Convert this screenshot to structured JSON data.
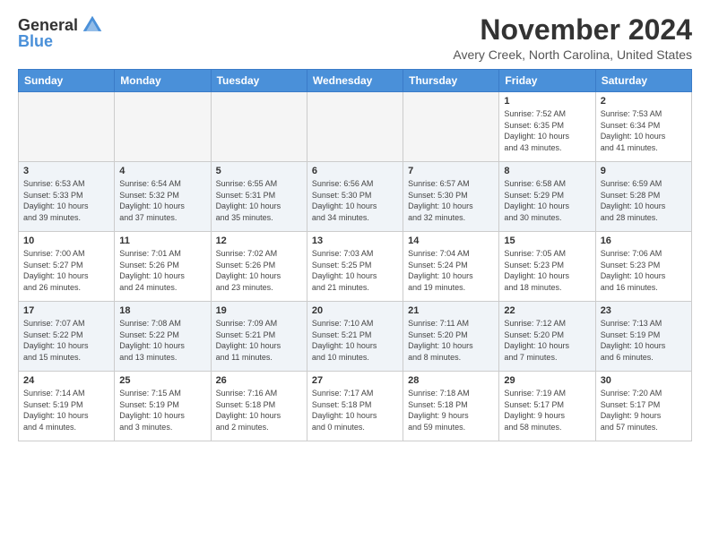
{
  "logo": {
    "general": "General",
    "blue": "Blue"
  },
  "header": {
    "month": "November 2024",
    "location": "Avery Creek, North Carolina, United States"
  },
  "weekdays": [
    "Sunday",
    "Monday",
    "Tuesday",
    "Wednesday",
    "Thursday",
    "Friday",
    "Saturday"
  ],
  "weeks": [
    [
      {
        "day": "",
        "info": ""
      },
      {
        "day": "",
        "info": ""
      },
      {
        "day": "",
        "info": ""
      },
      {
        "day": "",
        "info": ""
      },
      {
        "day": "",
        "info": ""
      },
      {
        "day": "1",
        "info": "Sunrise: 7:52 AM\nSunset: 6:35 PM\nDaylight: 10 hours\nand 43 minutes."
      },
      {
        "day": "2",
        "info": "Sunrise: 7:53 AM\nSunset: 6:34 PM\nDaylight: 10 hours\nand 41 minutes."
      }
    ],
    [
      {
        "day": "3",
        "info": "Sunrise: 6:53 AM\nSunset: 5:33 PM\nDaylight: 10 hours\nand 39 minutes."
      },
      {
        "day": "4",
        "info": "Sunrise: 6:54 AM\nSunset: 5:32 PM\nDaylight: 10 hours\nand 37 minutes."
      },
      {
        "day": "5",
        "info": "Sunrise: 6:55 AM\nSunset: 5:31 PM\nDaylight: 10 hours\nand 35 minutes."
      },
      {
        "day": "6",
        "info": "Sunrise: 6:56 AM\nSunset: 5:30 PM\nDaylight: 10 hours\nand 34 minutes."
      },
      {
        "day": "7",
        "info": "Sunrise: 6:57 AM\nSunset: 5:30 PM\nDaylight: 10 hours\nand 32 minutes."
      },
      {
        "day": "8",
        "info": "Sunrise: 6:58 AM\nSunset: 5:29 PM\nDaylight: 10 hours\nand 30 minutes."
      },
      {
        "day": "9",
        "info": "Sunrise: 6:59 AM\nSunset: 5:28 PM\nDaylight: 10 hours\nand 28 minutes."
      }
    ],
    [
      {
        "day": "10",
        "info": "Sunrise: 7:00 AM\nSunset: 5:27 PM\nDaylight: 10 hours\nand 26 minutes."
      },
      {
        "day": "11",
        "info": "Sunrise: 7:01 AM\nSunset: 5:26 PM\nDaylight: 10 hours\nand 24 minutes."
      },
      {
        "day": "12",
        "info": "Sunrise: 7:02 AM\nSunset: 5:26 PM\nDaylight: 10 hours\nand 23 minutes."
      },
      {
        "day": "13",
        "info": "Sunrise: 7:03 AM\nSunset: 5:25 PM\nDaylight: 10 hours\nand 21 minutes."
      },
      {
        "day": "14",
        "info": "Sunrise: 7:04 AM\nSunset: 5:24 PM\nDaylight: 10 hours\nand 19 minutes."
      },
      {
        "day": "15",
        "info": "Sunrise: 7:05 AM\nSunset: 5:23 PM\nDaylight: 10 hours\nand 18 minutes."
      },
      {
        "day": "16",
        "info": "Sunrise: 7:06 AM\nSunset: 5:23 PM\nDaylight: 10 hours\nand 16 minutes."
      }
    ],
    [
      {
        "day": "17",
        "info": "Sunrise: 7:07 AM\nSunset: 5:22 PM\nDaylight: 10 hours\nand 15 minutes."
      },
      {
        "day": "18",
        "info": "Sunrise: 7:08 AM\nSunset: 5:22 PM\nDaylight: 10 hours\nand 13 minutes."
      },
      {
        "day": "19",
        "info": "Sunrise: 7:09 AM\nSunset: 5:21 PM\nDaylight: 10 hours\nand 11 minutes."
      },
      {
        "day": "20",
        "info": "Sunrise: 7:10 AM\nSunset: 5:21 PM\nDaylight: 10 hours\nand 10 minutes."
      },
      {
        "day": "21",
        "info": "Sunrise: 7:11 AM\nSunset: 5:20 PM\nDaylight: 10 hours\nand 8 minutes."
      },
      {
        "day": "22",
        "info": "Sunrise: 7:12 AM\nSunset: 5:20 PM\nDaylight: 10 hours\nand 7 minutes."
      },
      {
        "day": "23",
        "info": "Sunrise: 7:13 AM\nSunset: 5:19 PM\nDaylight: 10 hours\nand 6 minutes."
      }
    ],
    [
      {
        "day": "24",
        "info": "Sunrise: 7:14 AM\nSunset: 5:19 PM\nDaylight: 10 hours\nand 4 minutes."
      },
      {
        "day": "25",
        "info": "Sunrise: 7:15 AM\nSunset: 5:19 PM\nDaylight: 10 hours\nand 3 minutes."
      },
      {
        "day": "26",
        "info": "Sunrise: 7:16 AM\nSunset: 5:18 PM\nDaylight: 10 hours\nand 2 minutes."
      },
      {
        "day": "27",
        "info": "Sunrise: 7:17 AM\nSunset: 5:18 PM\nDaylight: 10 hours\nand 0 minutes."
      },
      {
        "day": "28",
        "info": "Sunrise: 7:18 AM\nSunset: 5:18 PM\nDaylight: 9 hours\nand 59 minutes."
      },
      {
        "day": "29",
        "info": "Sunrise: 7:19 AM\nSunset: 5:17 PM\nDaylight: 9 hours\nand 58 minutes."
      },
      {
        "day": "30",
        "info": "Sunrise: 7:20 AM\nSunset: 5:17 PM\nDaylight: 9 hours\nand 57 minutes."
      }
    ]
  ]
}
